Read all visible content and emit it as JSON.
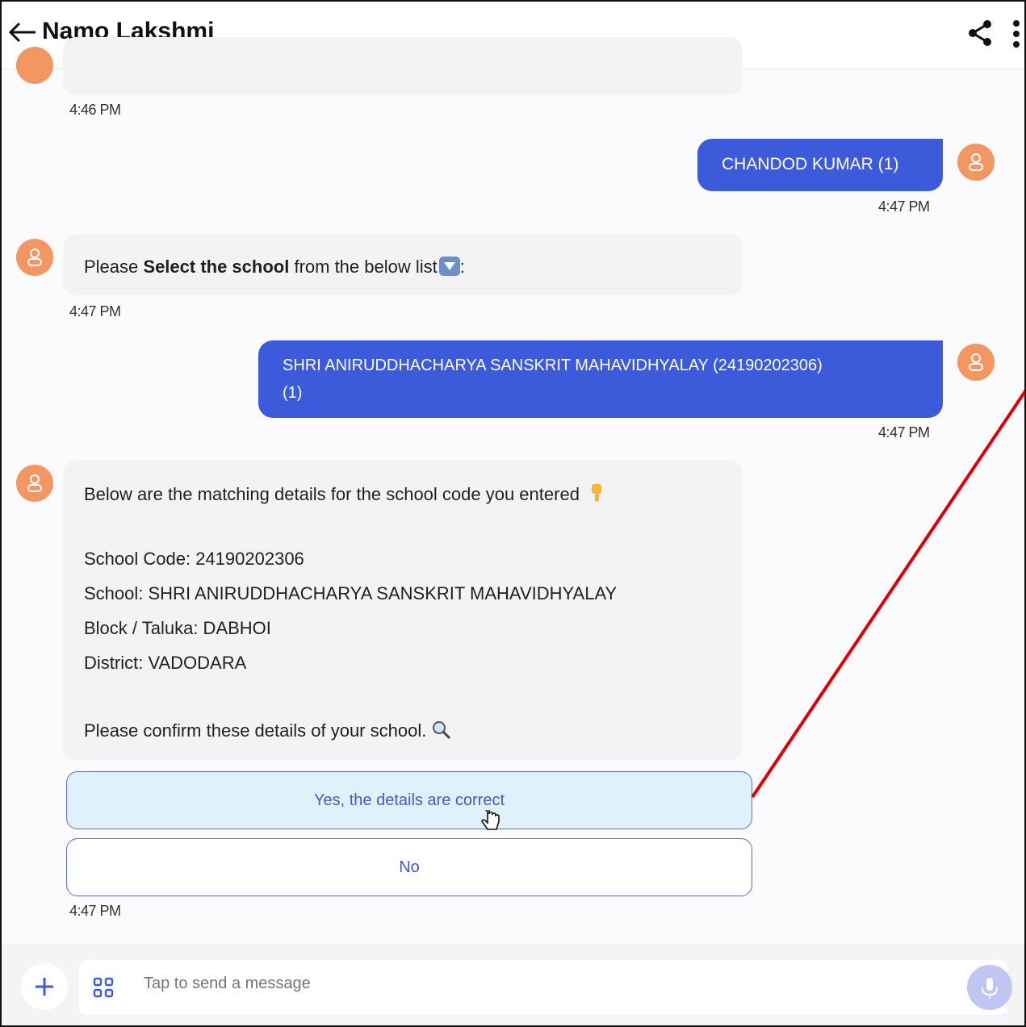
{
  "header": {
    "title": "Namo Lakshmi"
  },
  "messages": {
    "m0_time": "4:46 PM",
    "m1_text": "CHANDOD KUMAR (1)",
    "m1_time": "4:47 PM",
    "m2_prefix": "Please ",
    "m2_bold": "Select the school",
    "m2_suffix": " from the below list",
    "m2_tail": ":",
    "m2_time": "4:47 PM",
    "m3_line1": "SHRI ANIRUDDHACHARYA SANSKRIT MAHAVIDHYALAY (24190202306)",
    "m3_line2": "(1)",
    "m3_time": "4:47 PM",
    "m4_intro": "Below are the matching details for the school code you entered",
    "m4_code": "School Code: 24190202306",
    "m4_school": "School: SHRI ANIRUDDHACHARYA SANSKRIT MAHAVIDHYALAY",
    "m4_block": "Block / Taluka: DABHOI",
    "m4_district": "District: VADODARA",
    "m4_confirm": "Please confirm these details of your school.",
    "m4_time": "4:47 PM"
  },
  "choices": {
    "yes": "Yes, the details are correct",
    "no": "No"
  },
  "composer": {
    "placeholder": "Tap to send a message"
  },
  "colors": {
    "outgoing_bubble": "#3b5bdb",
    "avatar": "#f29662",
    "choice_border": "#5b6bd8",
    "annotation_line": "#e00000"
  }
}
